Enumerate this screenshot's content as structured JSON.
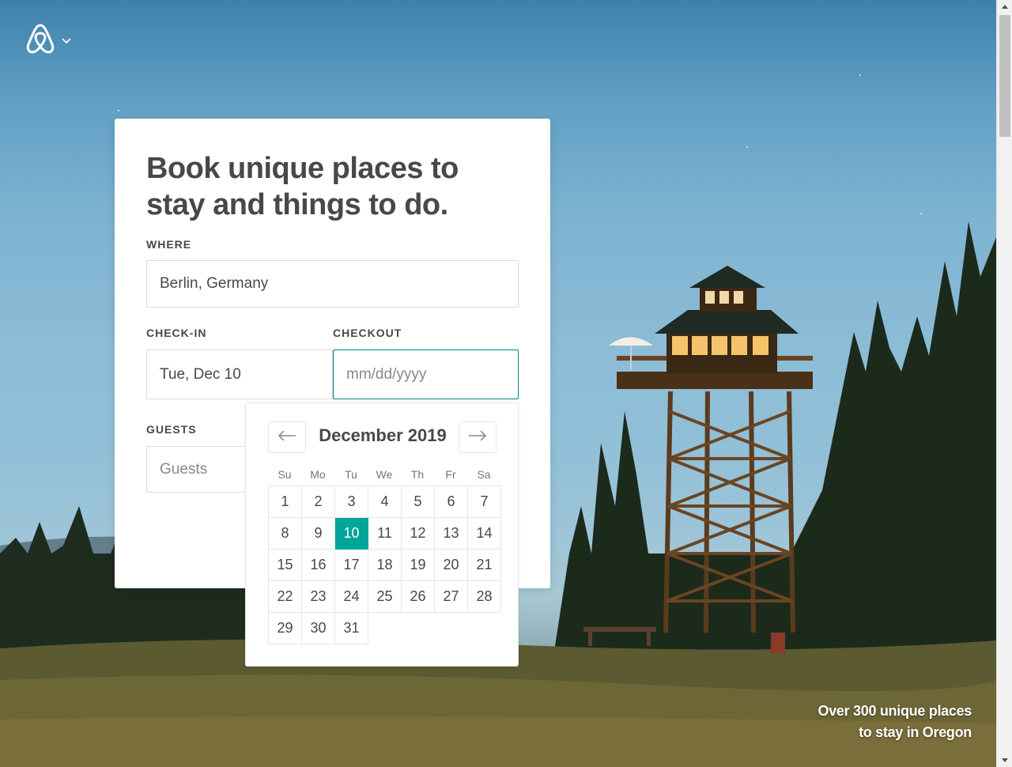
{
  "header": {
    "logo_icon": "airbnb-belo-icon",
    "menu_icon": "chevron-down-icon"
  },
  "hero": {
    "title": "Book unique places to stay and things to do.",
    "where": {
      "label": "WHERE",
      "value": "Berlin, Germany"
    },
    "checkin": {
      "label": "CHECK-IN",
      "value": "Tue, Dec 10"
    },
    "checkout": {
      "label": "CHECKOUT",
      "value": "",
      "placeholder": "mm/dd/yyyy"
    },
    "guests": {
      "label": "GUESTS",
      "value": "",
      "placeholder": "Guests"
    }
  },
  "calendar": {
    "month": "December 2019",
    "prev_icon": "arrow-left-icon",
    "next_icon": "arrow-right-icon",
    "weekdays": [
      "Su",
      "Mo",
      "Tu",
      "We",
      "Th",
      "Fr",
      "Sa"
    ],
    "weeks": [
      [
        "1",
        "2",
        "3",
        "4",
        "5",
        "6",
        "7"
      ],
      [
        "8",
        "9",
        "10",
        "11",
        "12",
        "13",
        "14"
      ],
      [
        "15",
        "16",
        "17",
        "18",
        "19",
        "20",
        "21"
      ],
      [
        "22",
        "23",
        "24",
        "25",
        "26",
        "27",
        "28"
      ],
      [
        "29",
        "30",
        "31",
        "",
        "",
        "",
        ""
      ]
    ],
    "selected_day": "10",
    "selected_color": "#00a699"
  },
  "caption": {
    "line1": "Over 300 unique places",
    "line2": "to stay in Oregon"
  },
  "colors": {
    "accent": "#008489",
    "text": "#484848"
  }
}
